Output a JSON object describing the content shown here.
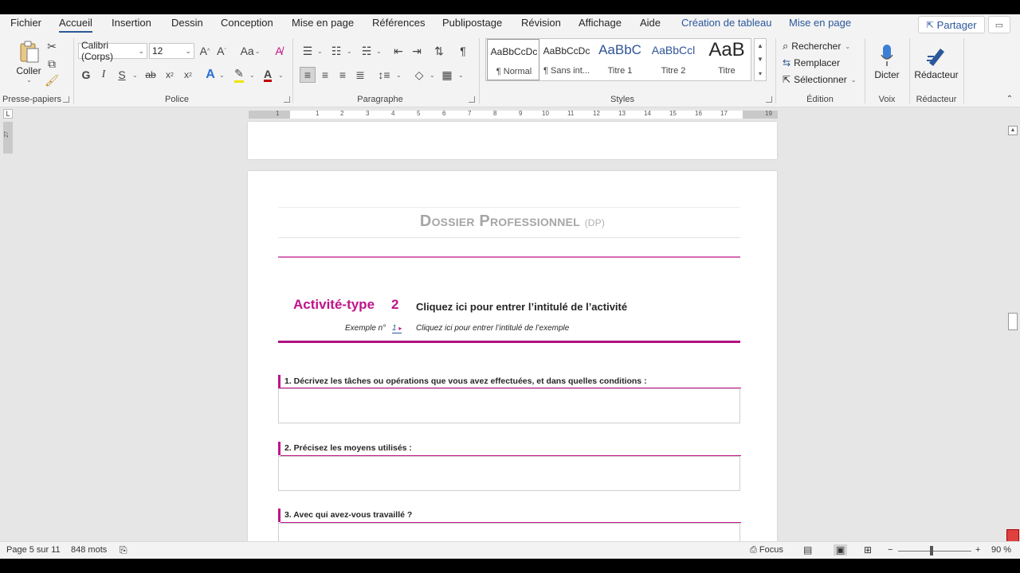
{
  "tabs": [
    "Fichier",
    "Accueil",
    "Insertion",
    "Dessin",
    "Conception",
    "Mise en page",
    "Références",
    "Publipostage",
    "Révision",
    "Affichage",
    "Aide"
  ],
  "context_tabs": [
    "Création de tableau",
    "Mise en page"
  ],
  "share_label": "Partager",
  "clipboard": {
    "paste_label": "Coller",
    "group_label": "Presse-papiers"
  },
  "font": {
    "name": "Calibri (Corps)",
    "size": "12",
    "group_label": "Police",
    "bold": "G",
    "italic": "I",
    "underline": "S",
    "strike": "ab"
  },
  "paragraph": {
    "group_label": "Paragraphe"
  },
  "styles": {
    "group_label": "Styles",
    "items": [
      {
        "sample": "AaBbCcDc",
        "name": "¶ Normal"
      },
      {
        "sample": "AaBbCcDc",
        "name": "¶ Sans int..."
      },
      {
        "sample": "AaBbC",
        "name": "Titre 1"
      },
      {
        "sample": "AaBbCcl",
        "name": "Titre 2"
      },
      {
        "sample": "AaB",
        "name": "Titre"
      }
    ]
  },
  "editing": {
    "find": "Rechercher",
    "replace": "Remplacer",
    "select": "Sélectionner",
    "group_label": "Édition"
  },
  "voice": {
    "dictate": "Dicter",
    "group_label": "Voix"
  },
  "editor": {
    "label": "Rédacteur",
    "group_label": "Rédacteur"
  },
  "ruler": {
    "numbers": [
      "1",
      "1",
      "2",
      "3",
      "4",
      "5",
      "6",
      "7",
      "8",
      "9",
      "10",
      "11",
      "12",
      "13",
      "14",
      "15",
      "16",
      "17",
      "19"
    ],
    "vertical": "27"
  },
  "document": {
    "title_main": "Dossier Professionnel",
    "title_abbr": "(DP)",
    "activity_label": "Activité-type",
    "activity_number": "2",
    "activity_title": "Cliquez ici pour entrer l’intitulé de l’activité",
    "example_label": "Exemple n°",
    "example_number": "1",
    "example_marker": "▸",
    "example_text": "Cliquez ici pour entrer l’intitulé de l’exemple",
    "questions": [
      "1. Décrivez les tâches ou opérations que vous avez effectuées, et dans quelles conditions :",
      "2. Précisez les moyens utilisés :",
      "3. Avec qui avez-vous travaillé ?"
    ]
  },
  "status": {
    "page": "Page 5 sur 11",
    "words": "848 mots",
    "focus": "Focus",
    "zoom_minus": "−",
    "zoom_plus": "+",
    "zoom": "90 %"
  },
  "colors": {
    "accent": "#2b579a",
    "magenta": "#c0148a"
  }
}
